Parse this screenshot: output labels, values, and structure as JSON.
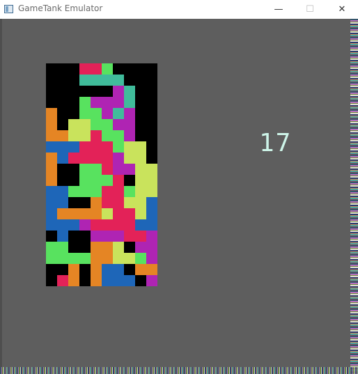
{
  "window": {
    "title": "GameTank Emulator",
    "min_glyph": "—",
    "max_glyph": "☐",
    "close_glyph": "✕"
  },
  "game": {
    "score": "17",
    "palette": {
      "R": "#e32258",
      "G": "#58e25f",
      "T": "#40bc9b",
      "P": "#af24b3",
      "O": "#e58524",
      "L": "#c9e35c",
      "B": "#1e66b8"
    },
    "board": [
      "...RRG....",
      "...TTTT...",
      "......PT..",
      "...GPPPT..",
      "O..GGPTP..",
      "O.LLGGPP..",
      "OOLLRGGP..",
      "BBBRRRGLL.",
      "OBRRRRPLL.",
      "O..GGRPPLL.",
      "O..GGGR.LL.",
      "BBGGGRRGLL",
      "BB..ORRLLB",
      "BOOOOLRRLB",
      "BBBPRRRRBB",
      ".B..PPPRRP",
      "GG..OOL.PP",
      "GGGGOOLLGP",
      "..O.OBB.OOT",
      ".RO.OBBB.PT",
      "RRP.OOGPPT"
    ]
  }
}
